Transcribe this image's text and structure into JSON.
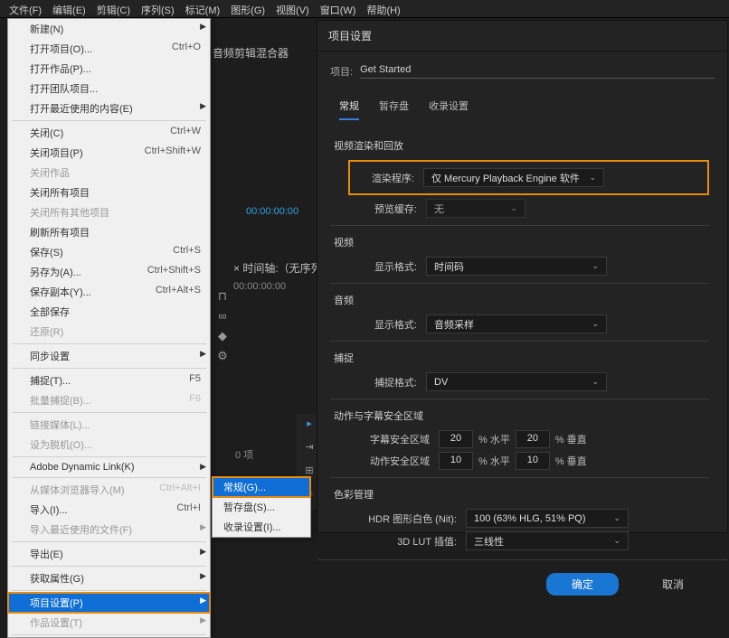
{
  "menubar": [
    "文件(F)",
    "编辑(E)",
    "剪辑(C)",
    "序列(S)",
    "标记(M)",
    "图形(G)",
    "视图(V)",
    "窗口(W)",
    "帮助(H)"
  ],
  "file_menu": [
    {
      "label": "新建(N)",
      "arrow": true
    },
    {
      "label": "打开项目(O)...",
      "shortcut": "Ctrl+O"
    },
    {
      "label": "打开作品(P)..."
    },
    {
      "label": "打开团队项目..."
    },
    {
      "label": "打开最近使用的内容(E)",
      "arrow": true
    },
    {
      "sep": true
    },
    {
      "label": "关闭(C)",
      "shortcut": "Ctrl+W"
    },
    {
      "label": "关闭项目(P)",
      "shortcut": "Ctrl+Shift+W"
    },
    {
      "label": "关闭作品",
      "disabled": true
    },
    {
      "label": "关闭所有项目"
    },
    {
      "label": "关闭所有其他项目",
      "disabled": true
    },
    {
      "label": "刷新所有项目"
    },
    {
      "label": "保存(S)",
      "shortcut": "Ctrl+S"
    },
    {
      "label": "另存为(A)...",
      "shortcut": "Ctrl+Shift+S"
    },
    {
      "label": "保存副本(Y)...",
      "shortcut": "Ctrl+Alt+S"
    },
    {
      "label": "全部保存"
    },
    {
      "label": "还原(R)",
      "disabled": true
    },
    {
      "sep": true
    },
    {
      "label": "同步设置",
      "arrow": true
    },
    {
      "sep": true
    },
    {
      "label": "捕捉(T)...",
      "shortcut": "F5"
    },
    {
      "label": "批量捕捉(B)...",
      "shortcut": "F6",
      "disabled": true
    },
    {
      "sep": true
    },
    {
      "label": "链接媒体(L)...",
      "disabled": true
    },
    {
      "label": "设为脱机(O)...",
      "disabled": true
    },
    {
      "sep": true
    },
    {
      "label": "Adobe Dynamic Link(K)",
      "arrow": true
    },
    {
      "sep": true
    },
    {
      "label": "从媒体浏览器导入(M)",
      "shortcut": "Ctrl+Alt+I",
      "disabled": true
    },
    {
      "label": "导入(I)...",
      "shortcut": "Ctrl+I"
    },
    {
      "label": "导入最近使用的文件(F)",
      "arrow": true,
      "disabled": true
    },
    {
      "sep": true
    },
    {
      "label": "导出(E)",
      "arrow": true
    },
    {
      "sep": true
    },
    {
      "label": "获取属性(G)",
      "arrow": true
    },
    {
      "sep": true
    },
    {
      "label": "项目设置(P)",
      "arrow": true,
      "selected": true
    },
    {
      "label": "作品设置(T)",
      "arrow": true,
      "disabled": true
    },
    {
      "sep": true
    }
  ],
  "submenu": [
    {
      "label": "常规(G)...",
      "selected": true
    },
    {
      "label": "暂存盘(S)..."
    },
    {
      "label": "收录设置(I)..."
    }
  ],
  "left_panel_title": "音频剪辑混合器",
  "left_timecode": "00:00:00:00",
  "timeline_header": "× 时间轴:（无序列）",
  "timeline_tc": "00:00:00:00",
  "project_count": "0 项",
  "dialog": {
    "title": "项目设置",
    "project_label": "项目:",
    "project_name": "Get Started",
    "tabs": [
      "常规",
      "暂存盘",
      "收录设置"
    ],
    "section_video_render": "视频渲染和回放",
    "renderer_label": "渲染程序:",
    "renderer_value": "仅 Mercury Playback Engine 软件",
    "preview_cache_label": "预览缓存:",
    "preview_cache_value": "无",
    "section_video": "视频",
    "vid_display_label": "显示格式:",
    "vid_display_value": "时间码",
    "section_audio": "音频",
    "aud_display_label": "显示格式:",
    "aud_display_value": "音频采样",
    "section_capture": "捕捉",
    "capture_label": "捕捉格式:",
    "capture_value": "DV",
    "section_action": "动作与字幕安全区域",
    "title_safe_label": "字幕安全区域",
    "action_safe_label": "动作安全区域",
    "title_safe_h": "20",
    "title_safe_v": "20",
    "action_safe_h": "10",
    "action_safe_v": "10",
    "pct_h": "% 水平",
    "pct_v": "% 垂直",
    "section_color": "色彩管理",
    "hdr_label": "HDR 图形白色 (Nit):",
    "hdr_value": "100 (63% HLG, 51% PQ)",
    "lut_label": "3D LUT 插值:",
    "lut_value": "三线性",
    "ok": "确定",
    "cancel": "取消"
  }
}
